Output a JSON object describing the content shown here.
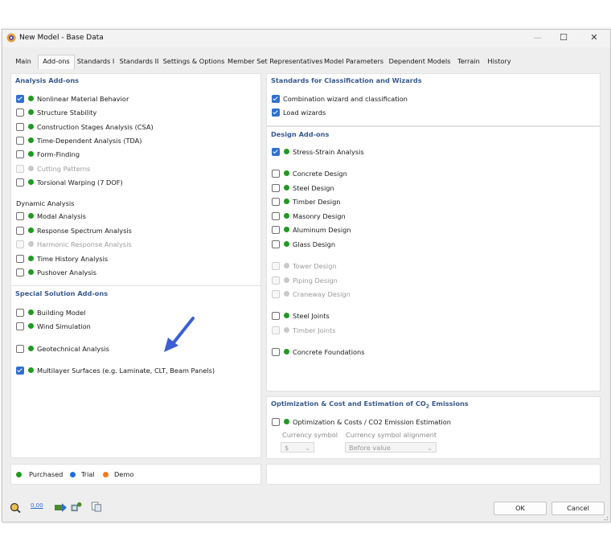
{
  "window": {
    "title": "New Model - Base Data"
  },
  "tabs": [
    "Main",
    "Add-ons",
    "Standards I",
    "Standards II",
    "Settings & Options",
    "Member Set Representatives",
    "Model Parameters",
    "Dependent Models",
    "Terrain",
    "History"
  ],
  "active_tab": "Add-ons",
  "analysis_addons": {
    "title": "Analysis Add-ons",
    "items": [
      {
        "label": "Nonlinear Material Behavior",
        "checked": true,
        "enabled": true
      },
      {
        "label": "Structure Stability",
        "checked": false,
        "enabled": true
      },
      {
        "label": "Construction Stages Analysis (CSA)",
        "checked": false,
        "enabled": true
      },
      {
        "label": "Time-Dependent Analysis (TDA)",
        "checked": false,
        "enabled": true
      },
      {
        "label": "Form-Finding",
        "checked": false,
        "enabled": true
      },
      {
        "label": "Cutting Patterns",
        "checked": false,
        "enabled": false
      },
      {
        "label": "Torsional Warping (7 DOF)",
        "checked": false,
        "enabled": true
      }
    ],
    "dynamic_title": "Dynamic Analysis",
    "dynamic_items": [
      {
        "label": "Modal Analysis",
        "checked": false,
        "enabled": true
      },
      {
        "label": "Response Spectrum Analysis",
        "checked": false,
        "enabled": true
      },
      {
        "label": "Harmonic Response Analysis",
        "checked": false,
        "enabled": false
      },
      {
        "label": "Time History Analysis",
        "checked": false,
        "enabled": true
      },
      {
        "label": "Pushover Analysis",
        "checked": false,
        "enabled": true
      }
    ]
  },
  "special_addons": {
    "title": "Special Solution Add-ons",
    "items": [
      {
        "label": "Building Model",
        "checked": false,
        "enabled": true
      },
      {
        "label": "Wind Simulation",
        "checked": false,
        "enabled": true
      },
      {
        "label": "Geotechnical Analysis",
        "checked": false,
        "enabled": true
      },
      {
        "label": "Multilayer Surfaces (e.g. Laminate, CLT, Beam Panels)",
        "checked": true,
        "enabled": true
      }
    ]
  },
  "legend": {
    "purchased": "Purchased",
    "trial": "Trial",
    "demo": "Demo",
    "colors": {
      "purchased": "#1f9a1f",
      "trial": "#1f6fd6",
      "demo": "#f07c1c"
    }
  },
  "standards": {
    "title": "Standards for Classification and Wizards",
    "items": [
      {
        "label": "Combination wizard and classification",
        "checked": true
      },
      {
        "label": "Load wizards",
        "checked": true
      }
    ]
  },
  "design_addons": {
    "title": "Design Add-ons",
    "items": [
      {
        "label": "Stress-Strain Analysis",
        "checked": true,
        "enabled": true
      },
      {
        "label": "Concrete Design",
        "checked": false,
        "enabled": true
      },
      {
        "label": "Steel Design",
        "checked": false,
        "enabled": true
      },
      {
        "label": "Timber Design",
        "checked": false,
        "enabled": true
      },
      {
        "label": "Masonry Design",
        "checked": false,
        "enabled": true
      },
      {
        "label": "Aluminum Design",
        "checked": false,
        "enabled": true
      },
      {
        "label": "Glass Design",
        "checked": false,
        "enabled": true
      },
      {
        "label": "Tower Design",
        "checked": false,
        "enabled": false
      },
      {
        "label": "Piping Design",
        "checked": false,
        "enabled": false
      },
      {
        "label": "Craneway Design",
        "checked": false,
        "enabled": false
      },
      {
        "label": "Steel Joints",
        "checked": false,
        "enabled": true
      },
      {
        "label": "Timber Joints",
        "checked": false,
        "enabled": false
      },
      {
        "label": "Concrete Foundations",
        "checked": false,
        "enabled": true
      }
    ]
  },
  "optimization": {
    "title_pre": "Optimization & Cost and Estimation of CO",
    "title_sub": "2",
    "title_post": " Emissions",
    "item": {
      "label": "Optimization & Costs / CO2 Emission Estimation",
      "checked": false,
      "enabled": true
    },
    "currency_symbol_label": "Currency symbol",
    "currency_symbol_value": "$",
    "currency_alignment_label": "Currency symbol alignment",
    "currency_alignment_value": "Before value"
  },
  "toolbar_icons": [
    "search-icon",
    "decimal-places-icon",
    "units-icon",
    "model-settings-icon",
    "copy-icon"
  ],
  "toolbar_text": {
    "decimals": "0,00"
  },
  "buttons": {
    "ok": "OK",
    "cancel": "Cancel"
  },
  "window_controls": {
    "minimize": "—",
    "maximize": "☐",
    "close": "✕"
  },
  "accent": "#2f6fcf"
}
